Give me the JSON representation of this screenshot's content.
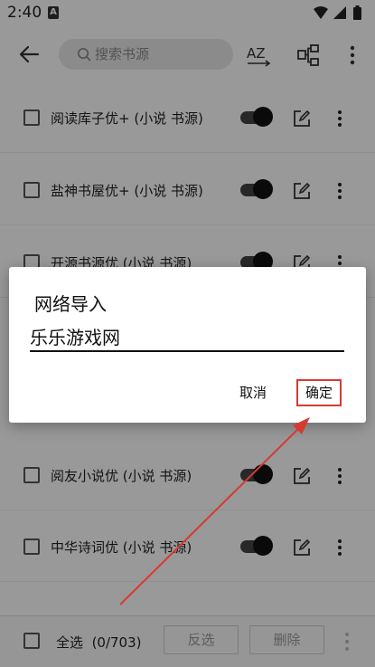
{
  "status_bar": {
    "time": "2:40",
    "notification_badge": "A"
  },
  "toolbar": {
    "search_placeholder": "搜索书源",
    "sort_label": "AZ"
  },
  "list": {
    "items": [
      {
        "label": "阅读库子优+ (小说 书源)",
        "checked": false,
        "enabled": true
      },
      {
        "label": "盐神书屋优+ (小说 书源)",
        "checked": false,
        "enabled": true
      },
      {
        "label": "开源书源优 (小说 书源)",
        "checked": false,
        "enabled": true
      },
      {
        "label": "阅友小说优 (小说 书源)",
        "checked": false,
        "enabled": true
      },
      {
        "label": "中华诗词优 (小说 书源)",
        "checked": false,
        "enabled": true
      }
    ]
  },
  "bottom_bar": {
    "select_all_label": "全选",
    "count": "(0/703)",
    "invert_label": "反选",
    "delete_label": "删除"
  },
  "dialog": {
    "title": "网络导入",
    "input_value": "乐乐游戏网",
    "cancel_label": "取消",
    "ok_label": "确定"
  },
  "colors": {
    "annotation_red": "#d63b31"
  }
}
